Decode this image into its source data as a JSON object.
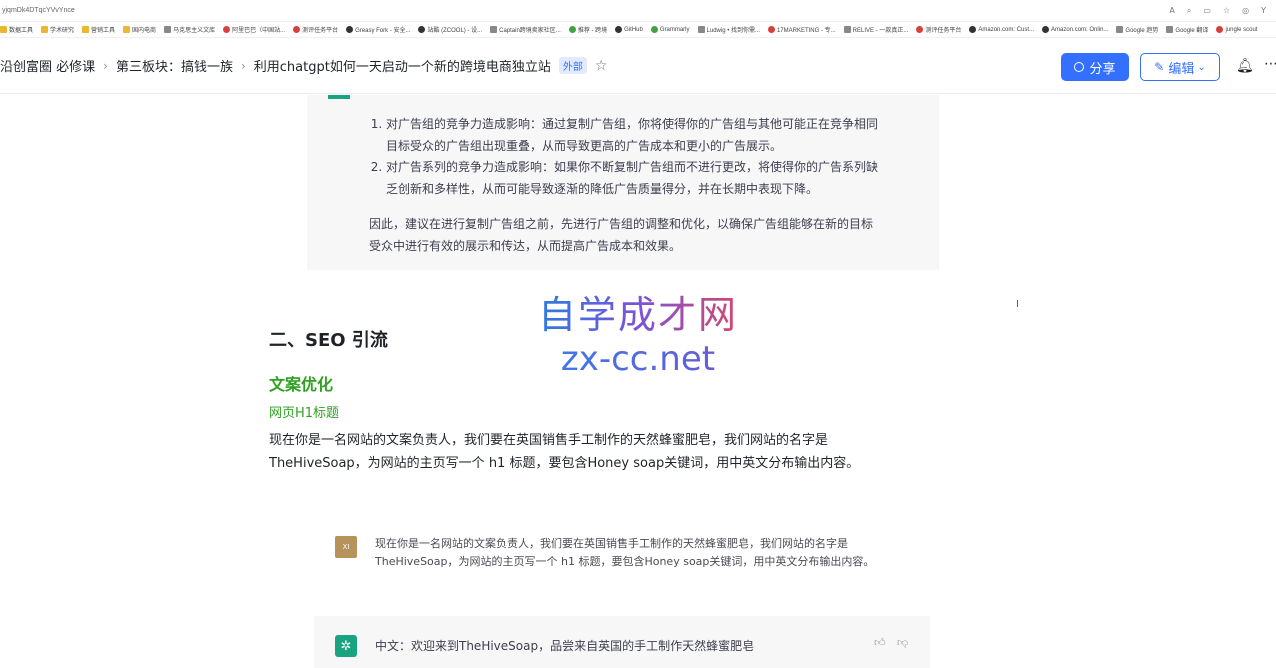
{
  "browser": {
    "url": "yjqmDk4DTqcYVvYnce",
    "bookmarks": [
      "数据工具",
      "学术研究",
      "营销工具",
      "国内电商",
      "马克思主义文库",
      "阿里巴巴（中国站...",
      "测评任务平台",
      "Greasy Fork - 安全...",
      "站酷 (ZCOOL) - 设...",
      "Captain跨境卖家社区...",
      "推荐 - 跨境",
      "GitHub",
      "Grammarly",
      "Ludwig • 找到你需...",
      "17MARKETING - 专...",
      "RELIVE - 一款真正...",
      "测评任务平台",
      "Amazon.com: Cust...",
      "Amazon.com: Onlin...",
      "Google 趋势",
      "Google 翻译",
      "jungle scout"
    ]
  },
  "header": {
    "breadcrumbs": [
      "沿创富圈 必修课",
      "第三板块：搞钱一族",
      "利用chatgpt如何一天启动一个新的跨境电商独立站"
    ],
    "tag": "外部",
    "share_label": "分享",
    "edit_label": "编辑"
  },
  "doc": {
    "list_items": [
      "对广告组的竞争力造成影响：通过复制广告组，你将使得你的广告组与其他可能正在竞争相同目标受众的广告组出现重叠，从而导致更高的广告成本和更小的广告展示。",
      "对广告系列的竞争力造成影响：如果你不断复制广告组而不进行更改，将使得你的广告系列缺乏创新和多样性，从而可能导致逐渐的降低广告质量得分，并在长期中表现下降。"
    ],
    "conclusion": "因此，建议在进行复制广告组之前，先进行广告组的调整和优化，以确保广告组能够在新的目标受众中进行有效的展示和传达，从而提高广告成本和效果。",
    "watermark_cn": "自学成才网",
    "watermark_en": "zx-cc.net",
    "section_title": "二、SEO 引流",
    "subsection_title": "文案优化",
    "subsubsection_title": "网页H1标题",
    "paragraph": " 现在你是一名网站的文案负责人，我们要在英国销售手工制作的天然蜂蜜肥皂，我们网站的名字是TheHiveSoap，为网站的主页写一个 h1 标题，要包含Honey soap关键词，用中英文分布输出内容。",
    "avatar_label": "XI",
    "question": "现在你是一名网站的文案负责人，我们要在英国销售手工制作的天然蜂蜜肥皂，我们网站的名字是TheHiveSoap，为网站的主页写一个 h1 标题，要包含Honey soap关键词，用中英文分布输出内容。",
    "answer": "中文：欢迎来到TheHiveSoap，品尝来自英国的手工制作天然蜂蜜肥皂"
  }
}
